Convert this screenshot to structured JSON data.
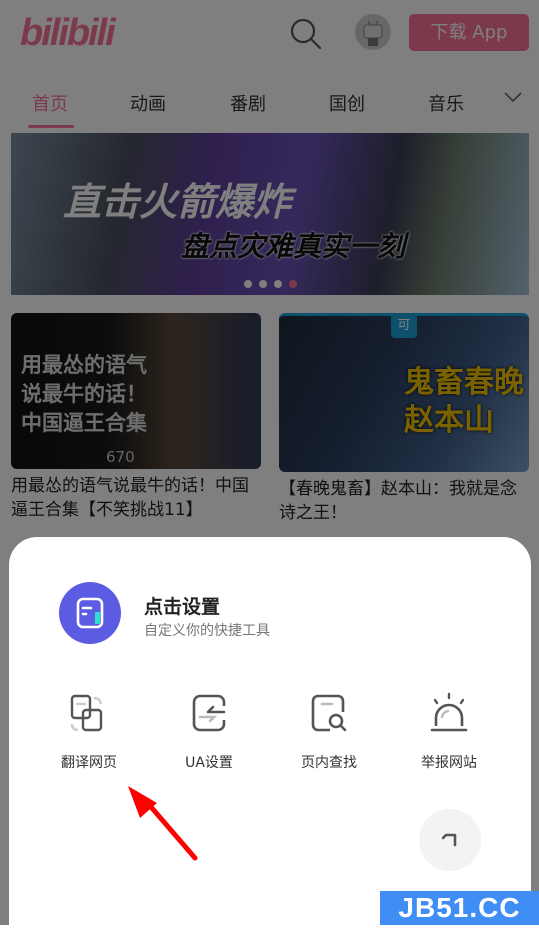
{
  "header": {
    "logo": "bilibili",
    "download_button": "下载 App",
    "brand_color": "#fb7299"
  },
  "tabs": [
    {
      "label": "首页",
      "active": true
    },
    {
      "label": "动画",
      "active": false
    },
    {
      "label": "番剧",
      "active": false
    },
    {
      "label": "国创",
      "active": false
    },
    {
      "label": "音乐",
      "active": false
    }
  ],
  "banner": {
    "title": "直击火箭爆炸",
    "subtitle": "盘点灾难真实一刻",
    "slide_count": 4,
    "active_slide": 4
  },
  "videos": [
    {
      "thumb_text": "用最怂的语气\n说最牛的话！\n中国逼王合集",
      "thumb_views": "670",
      "title": "用最怂的语气说最牛的话！中国逼王合集【不笑挑战11】"
    },
    {
      "thumb_badge": "可",
      "thumb_text": "鬼畜春晚\n赵本山",
      "title": "【春晚鬼畜】赵本山：我就是念诗之王！"
    }
  ],
  "sheet": {
    "title": "点击设置",
    "subtitle": "自定义你的快捷工具",
    "accent_color": "#5b5ce2",
    "tools": [
      {
        "icon": "translate-icon",
        "label": "翻译网页"
      },
      {
        "icon": "ua-settings-icon",
        "label": "UA设置"
      },
      {
        "icon": "find-in-page-icon",
        "label": "页内查找"
      },
      {
        "icon": "report-alarm-icon",
        "label": "举报网站"
      }
    ]
  },
  "watermark": "JB51.CC"
}
